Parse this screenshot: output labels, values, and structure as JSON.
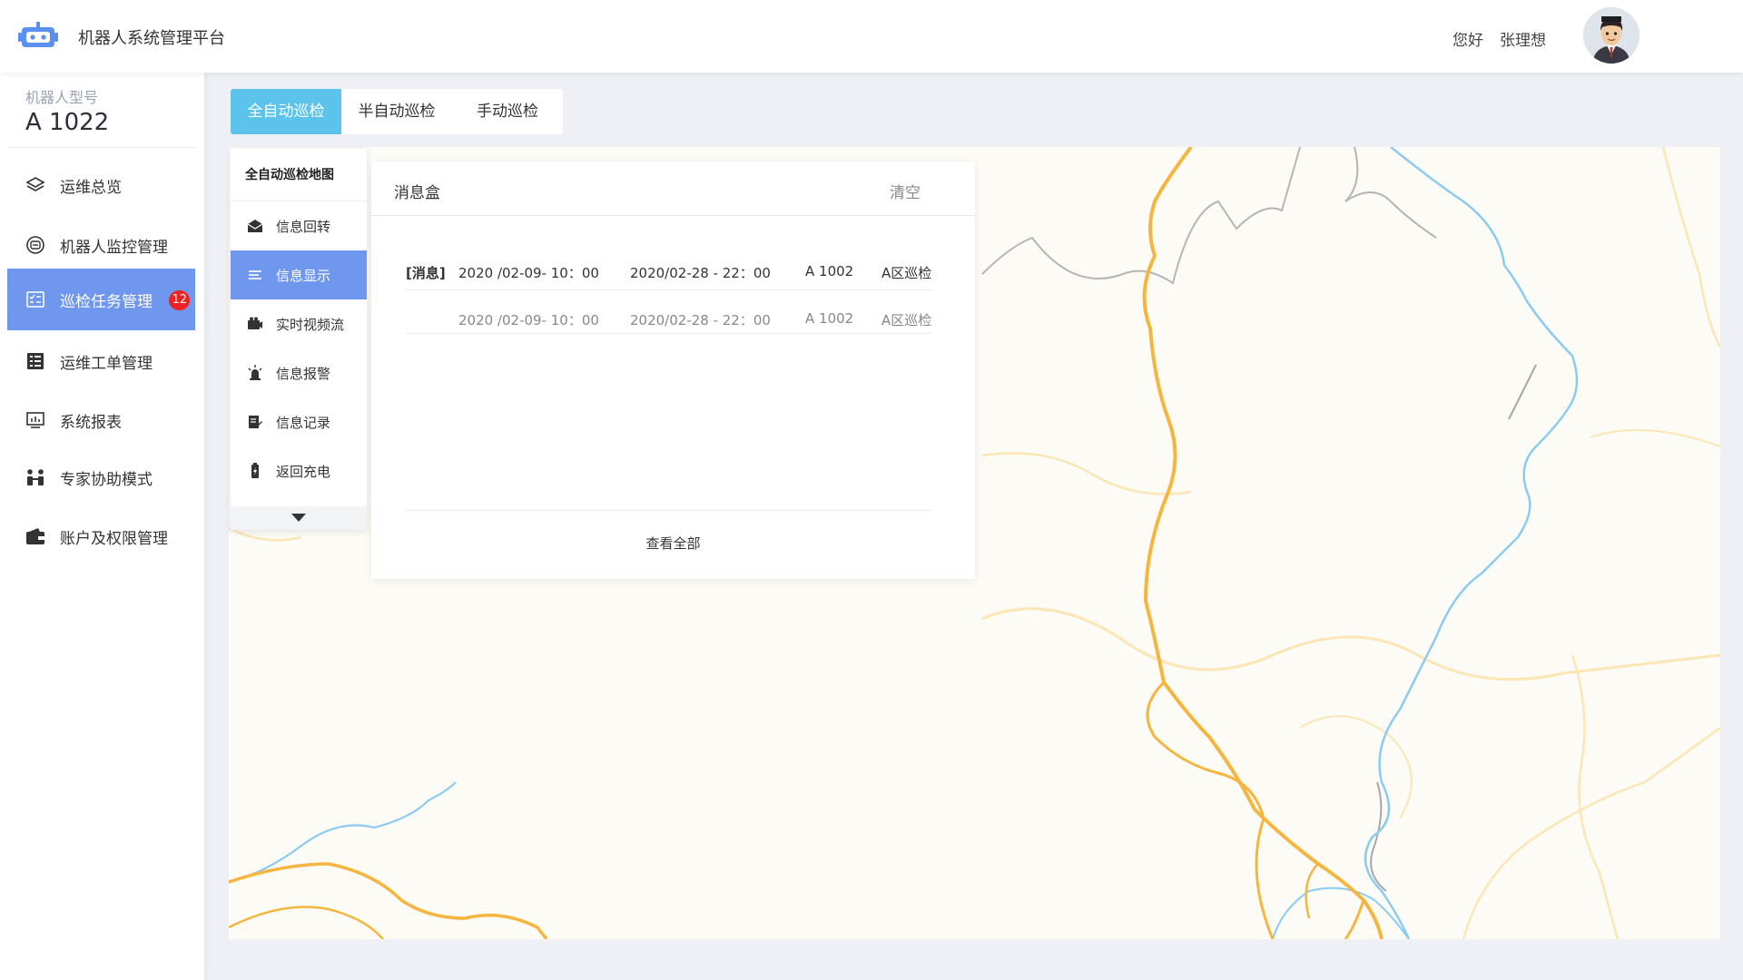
{
  "header": {
    "title": "机器人系统管理平台",
    "greeting": "您好",
    "username": "张理想"
  },
  "sidebar": {
    "model_label": "机器人型号",
    "model_value": "A 1022",
    "items": [
      {
        "label": "运维总览",
        "icon": "layers-icon"
      },
      {
        "label": "机器人监控管理",
        "icon": "robot-monitor-icon"
      },
      {
        "label": "巡检任务管理",
        "icon": "task-checklist-icon",
        "active": true,
        "badge": "12"
      },
      {
        "label": "运维工单管理",
        "icon": "work-order-icon"
      },
      {
        "label": "系统报表",
        "icon": "report-screen-icon"
      },
      {
        "label": "专家协助模式",
        "icon": "experts-icon"
      },
      {
        "label": "账户及权限管理",
        "icon": "wallet-icon"
      }
    ]
  },
  "tabs": [
    {
      "label": "全自动巡检",
      "active": true
    },
    {
      "label": "半自动巡检"
    },
    {
      "label": "手动巡检"
    }
  ],
  "func_menu": {
    "title": "全自动巡检地图",
    "items": [
      {
        "label": "信息回转",
        "icon": "envelope-icon"
      },
      {
        "label": "信息显示",
        "icon": "list-icon",
        "active": true
      },
      {
        "label": "实时视频流",
        "icon": "camera-icon"
      },
      {
        "label": "信息报警",
        "icon": "alarm-light-icon"
      },
      {
        "label": "信息记录",
        "icon": "edit-record-icon"
      },
      {
        "label": "返回充电",
        "icon": "battery-icon"
      }
    ]
  },
  "message_box": {
    "title": "消息盒",
    "clear": "清空",
    "rows": [
      {
        "tag": "[消息]",
        "start": "2020 /02-09- 10：00",
        "end": "2020/02-28 - 22：00",
        "robot": "A 1002",
        "task": "A区巡检"
      },
      {
        "tag": "",
        "start": "2020 /02-09- 10：00",
        "end": "2020/02-28 - 22：00",
        "robot": "A 1002",
        "task": "A区巡检"
      }
    ],
    "view_all": "查看全部"
  },
  "colors": {
    "accent_blue": "#6f97ee",
    "tab_active": "#5cc3ea",
    "badge": "#e22222",
    "road": "#f5b640",
    "river": "#8ccbf0"
  }
}
